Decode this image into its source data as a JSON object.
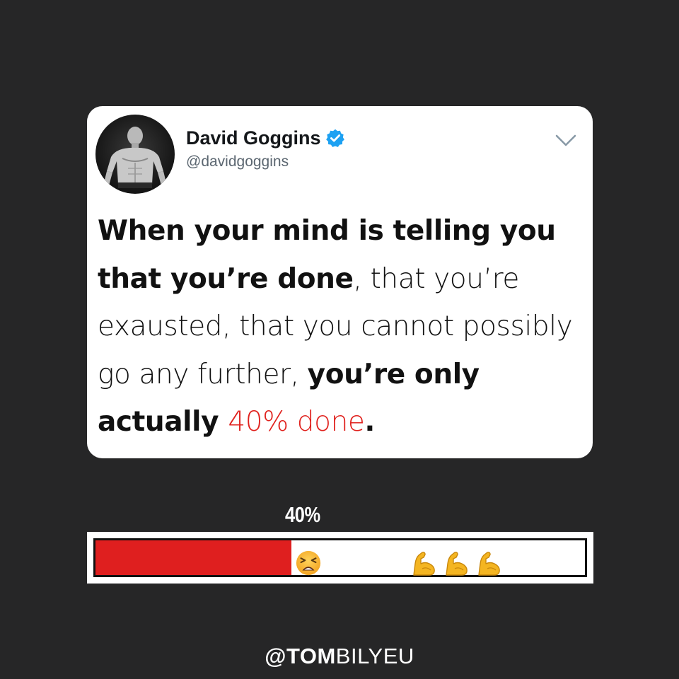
{
  "tweet": {
    "author_name": "David Goggins",
    "author_handle": "@davidgoggins",
    "verified_icon": "verified-badge-icon",
    "avatar": "profile-photo",
    "menu_icon": "chevron-down-icon",
    "text": {
      "part1_bold": "When your mind is telling you that you’re done",
      "part2": ", that you’re exausted, that you cannot possibly go any further, ",
      "part3_bold": "you’re only actually ",
      "part4_red": "40% done",
      "part5_bold": "."
    },
    "accent_red": "#e0221e",
    "verified_color": "#1da1f2"
  },
  "progress": {
    "label": "40%",
    "fill_fraction": 0.4,
    "fill_color": "#df1f1f",
    "marker_icon": "tired-face-icon",
    "remaining_icons": [
      "flexed-biceps-icon",
      "flexed-biceps-icon",
      "flexed-biceps-icon"
    ]
  },
  "watermark": {
    "bold_part": "@TOM",
    "light_part": "BILYEU"
  },
  "colors": {
    "background": "#262627",
    "card": "#ffffff"
  }
}
